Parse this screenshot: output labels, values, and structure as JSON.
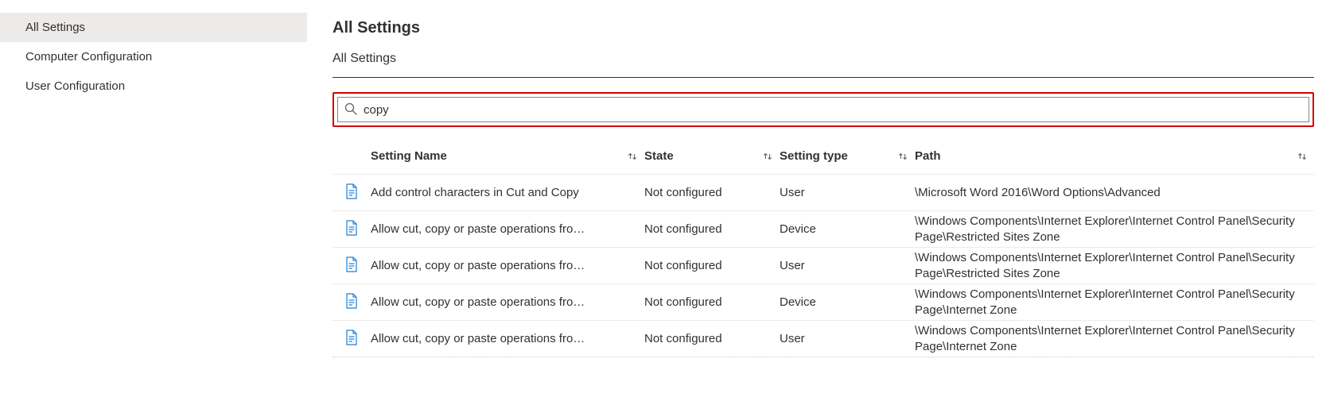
{
  "sidebar": {
    "items": [
      {
        "label": "All Settings",
        "selected": true
      },
      {
        "label": "Computer Configuration",
        "selected": false
      },
      {
        "label": "User Configuration",
        "selected": false
      }
    ]
  },
  "header": {
    "title": "All Settings",
    "breadcrumb": "All Settings"
  },
  "search": {
    "value": "copy",
    "placeholder": "Search"
  },
  "table": {
    "columns": [
      {
        "key": "name",
        "label": "Setting Name"
      },
      {
        "key": "state",
        "label": "State"
      },
      {
        "key": "type",
        "label": "Setting type"
      },
      {
        "key": "path",
        "label": "Path"
      }
    ],
    "rows": [
      {
        "name": "Add control characters in Cut and Copy",
        "state": "Not configured",
        "type": "User",
        "path": "\\Microsoft Word 2016\\Word Options\\Advanced"
      },
      {
        "name": "Allow cut, copy or paste operations fro…",
        "state": "Not configured",
        "type": "Device",
        "path": "\\Windows Components\\Internet Explorer\\Internet Control Panel\\Security Page\\Restricted Sites Zone"
      },
      {
        "name": "Allow cut, copy or paste operations fro…",
        "state": "Not configured",
        "type": "User",
        "path": "\\Windows Components\\Internet Explorer\\Internet Control Panel\\Security Page\\Restricted Sites Zone"
      },
      {
        "name": "Allow cut, copy or paste operations fro…",
        "state": "Not configured",
        "type": "Device",
        "path": "\\Windows Components\\Internet Explorer\\Internet Control Panel\\Security Page\\Internet Zone"
      },
      {
        "name": "Allow cut, copy or paste operations fro…",
        "state": "Not configured",
        "type": "User",
        "path": "\\Windows Components\\Internet Explorer\\Internet Control Panel\\Security Page\\Internet Zone"
      }
    ]
  }
}
